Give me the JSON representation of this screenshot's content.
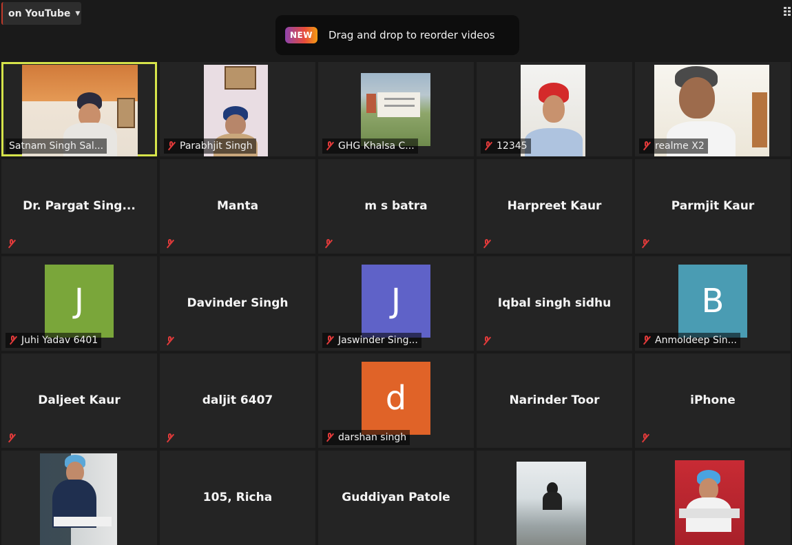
{
  "top_bar": {
    "stream_dropdown_label": "on YouTube",
    "toast_badge": "NEW",
    "toast_text": "Drag and drop to reorder videos"
  },
  "colors": {
    "active_speaker_border": "#d6e44a",
    "muted_icon": "#e03a3a",
    "avatar_green": "#7aa63a",
    "avatar_purple": "#5f62c8",
    "avatar_teal": "#4a9cb3",
    "avatar_orange": "#e06328"
  },
  "participants": [
    {
      "name": "Satnam Singh Sal...",
      "kind": "video",
      "active_speaker": true,
      "muted": false
    },
    {
      "name": "Parabhjit Singh",
      "kind": "video",
      "muted": true
    },
    {
      "name": "GHG Khalsa C...",
      "kind": "video",
      "muted": true
    },
    {
      "name": "12345",
      "kind": "video",
      "muted": true
    },
    {
      "name": "realme X2",
      "kind": "video",
      "muted": true
    },
    {
      "name": "Dr.  Pargat  Sing...",
      "kind": "name",
      "muted": true
    },
    {
      "name": "Manta",
      "kind": "name",
      "muted": true
    },
    {
      "name": "m s batra",
      "kind": "name",
      "muted": true
    },
    {
      "name": "Harpreet Kaur",
      "kind": "name",
      "muted": true
    },
    {
      "name": "Parmjit Kaur",
      "kind": "name",
      "muted": true
    },
    {
      "name": "Juhi Yadav 6401",
      "kind": "avatar",
      "initial": "J",
      "muted": true
    },
    {
      "name": "Davinder Singh",
      "kind": "name",
      "muted": true
    },
    {
      "name": "Jaswinder Sing...",
      "kind": "avatar",
      "initial": "J",
      "muted": true
    },
    {
      "name": "Iqbal singh sidhu",
      "kind": "name",
      "muted": true
    },
    {
      "name": "Anmoldeep Sin...",
      "kind": "avatar",
      "initial": "B",
      "muted": true
    },
    {
      "name": "Daljeet Kaur",
      "kind": "name",
      "muted": true
    },
    {
      "name": "daljit 6407",
      "kind": "name",
      "muted": true
    },
    {
      "name": "darshan singh",
      "kind": "avatar",
      "initial": "d",
      "muted": true
    },
    {
      "name": "Narinder Toor",
      "kind": "name",
      "muted": true
    },
    {
      "name": "iPhone",
      "kind": "name",
      "muted": true
    },
    {
      "name": "",
      "kind": "video",
      "muted": false
    },
    {
      "name": "105, Richa",
      "kind": "name",
      "muted": false
    },
    {
      "name": "Guddiyan Patole",
      "kind": "name",
      "muted": false
    },
    {
      "name": "",
      "kind": "video",
      "muted": false
    },
    {
      "name": "",
      "kind": "video",
      "muted": false
    }
  ]
}
